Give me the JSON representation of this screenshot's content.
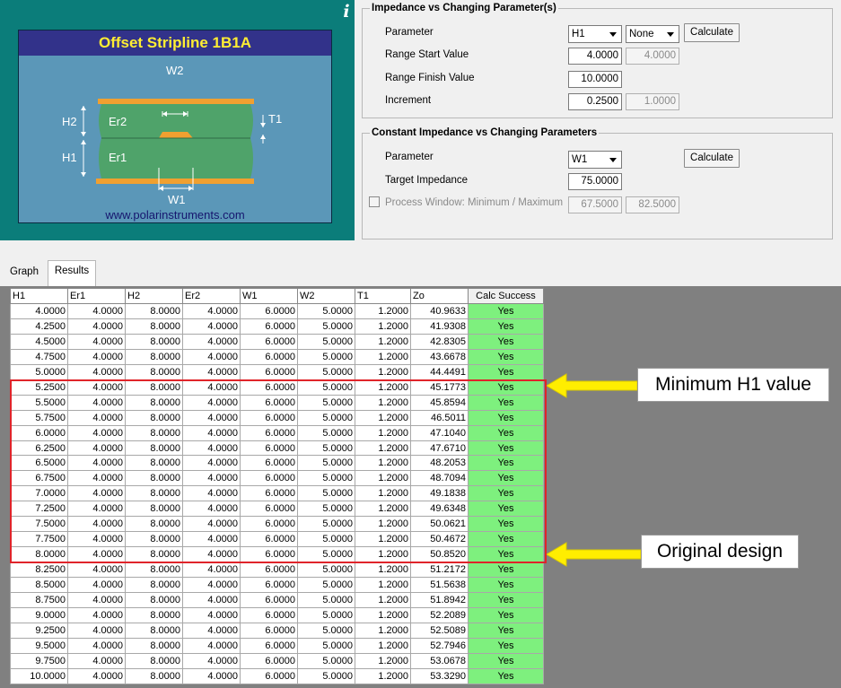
{
  "diagram": {
    "title": "Offset Stripline 1B1A",
    "url": "www.polarinstruments.com",
    "labels": {
      "w2": "W2",
      "w1": "W1",
      "h2": "H2",
      "h1": "H1",
      "er2": "Er2",
      "er1": "Er1",
      "t1": "T1"
    },
    "info_icon": "i"
  },
  "impedance_group": {
    "title": "Impedance vs Changing Parameter(s)",
    "parameter_label": "Parameter",
    "parameter_select": "H1",
    "second_select": "None",
    "calculate_label": "Calculate",
    "range_start_label": "Range Start Value",
    "range_start_value": "4.0000",
    "range_start_value2": "4.0000",
    "range_finish_label": "Range Finish Value",
    "range_finish_value": "10.0000",
    "increment_label": "Increment",
    "increment_value": "0.2500",
    "increment_value2": "1.0000"
  },
  "constant_group": {
    "title": "Constant Impedance vs Changing Parameters",
    "parameter_label": "Parameter",
    "parameter_select": "W1",
    "calculate_label": "Calculate",
    "target_label": "Target Impedance",
    "target_value": "75.0000",
    "process_window_label": "Process Window: Minimum / Maximum",
    "process_min": "67.5000",
    "process_max": "82.5000"
  },
  "tabs": [
    {
      "label": "Graph",
      "active": false
    },
    {
      "label": "Results",
      "active": true
    }
  ],
  "results": {
    "columns": [
      "H1",
      "Er1",
      "H2",
      "Er2",
      "W1",
      "W2",
      "T1",
      "Zo",
      "Calc Success"
    ],
    "rows": [
      [
        "4.0000",
        "4.0000",
        "8.0000",
        "4.0000",
        "6.0000",
        "5.0000",
        "1.2000",
        "40.9633",
        "Yes"
      ],
      [
        "4.2500",
        "4.0000",
        "8.0000",
        "4.0000",
        "6.0000",
        "5.0000",
        "1.2000",
        "41.9308",
        "Yes"
      ],
      [
        "4.5000",
        "4.0000",
        "8.0000",
        "4.0000",
        "6.0000",
        "5.0000",
        "1.2000",
        "42.8305",
        "Yes"
      ],
      [
        "4.7500",
        "4.0000",
        "8.0000",
        "4.0000",
        "6.0000",
        "5.0000",
        "1.2000",
        "43.6678",
        "Yes"
      ],
      [
        "5.0000",
        "4.0000",
        "8.0000",
        "4.0000",
        "6.0000",
        "5.0000",
        "1.2000",
        "44.4491",
        "Yes"
      ],
      [
        "5.2500",
        "4.0000",
        "8.0000",
        "4.0000",
        "6.0000",
        "5.0000",
        "1.2000",
        "45.1773",
        "Yes"
      ],
      [
        "5.5000",
        "4.0000",
        "8.0000",
        "4.0000",
        "6.0000",
        "5.0000",
        "1.2000",
        "45.8594",
        "Yes"
      ],
      [
        "5.7500",
        "4.0000",
        "8.0000",
        "4.0000",
        "6.0000",
        "5.0000",
        "1.2000",
        "46.5011",
        "Yes"
      ],
      [
        "6.0000",
        "4.0000",
        "8.0000",
        "4.0000",
        "6.0000",
        "5.0000",
        "1.2000",
        "47.1040",
        "Yes"
      ],
      [
        "6.2500",
        "4.0000",
        "8.0000",
        "4.0000",
        "6.0000",
        "5.0000",
        "1.2000",
        "47.6710",
        "Yes"
      ],
      [
        "6.5000",
        "4.0000",
        "8.0000",
        "4.0000",
        "6.0000",
        "5.0000",
        "1.2000",
        "48.2053",
        "Yes"
      ],
      [
        "6.7500",
        "4.0000",
        "8.0000",
        "4.0000",
        "6.0000",
        "5.0000",
        "1.2000",
        "48.7094",
        "Yes"
      ],
      [
        "7.0000",
        "4.0000",
        "8.0000",
        "4.0000",
        "6.0000",
        "5.0000",
        "1.2000",
        "49.1838",
        "Yes"
      ],
      [
        "7.2500",
        "4.0000",
        "8.0000",
        "4.0000",
        "6.0000",
        "5.0000",
        "1.2000",
        "49.6348",
        "Yes"
      ],
      [
        "7.5000",
        "4.0000",
        "8.0000",
        "4.0000",
        "6.0000",
        "5.0000",
        "1.2000",
        "50.0621",
        "Yes"
      ],
      [
        "7.7500",
        "4.0000",
        "8.0000",
        "4.0000",
        "6.0000",
        "5.0000",
        "1.2000",
        "50.4672",
        "Yes"
      ],
      [
        "8.0000",
        "4.0000",
        "8.0000",
        "4.0000",
        "6.0000",
        "5.0000",
        "1.2000",
        "50.8520",
        "Yes"
      ],
      [
        "8.2500",
        "4.0000",
        "8.0000",
        "4.0000",
        "6.0000",
        "5.0000",
        "1.2000",
        "51.2172",
        "Yes"
      ],
      [
        "8.5000",
        "4.0000",
        "8.0000",
        "4.0000",
        "6.0000",
        "5.0000",
        "1.2000",
        "51.5638",
        "Yes"
      ],
      [
        "8.7500",
        "4.0000",
        "8.0000",
        "4.0000",
        "6.0000",
        "5.0000",
        "1.2000",
        "51.8942",
        "Yes"
      ],
      [
        "9.0000",
        "4.0000",
        "8.0000",
        "4.0000",
        "6.0000",
        "5.0000",
        "1.2000",
        "52.2089",
        "Yes"
      ],
      [
        "9.2500",
        "4.0000",
        "8.0000",
        "4.0000",
        "6.0000",
        "5.0000",
        "1.2000",
        "52.5089",
        "Yes"
      ],
      [
        "9.5000",
        "4.0000",
        "8.0000",
        "4.0000",
        "6.0000",
        "5.0000",
        "1.2000",
        "52.7946",
        "Yes"
      ],
      [
        "9.7500",
        "4.0000",
        "8.0000",
        "4.0000",
        "6.0000",
        "5.0000",
        "1.2000",
        "53.0678",
        "Yes"
      ],
      [
        "10.0000",
        "4.0000",
        "8.0000",
        "4.0000",
        "6.0000",
        "5.0000",
        "1.2000",
        "53.3290",
        "Yes"
      ]
    ]
  },
  "annotations": {
    "minimum_label": "Minimum H1 value",
    "original_label": "Original design",
    "highlight_color": "#e0242a",
    "arrow_color": "#ffee00"
  },
  "colors": {
    "diagram_background": "#0b7d7a",
    "diagram_title_bar": "#32328a",
    "diagram_title_text": "#ffee33",
    "success_green": "#7ef07e",
    "results_background": "#808080"
  }
}
